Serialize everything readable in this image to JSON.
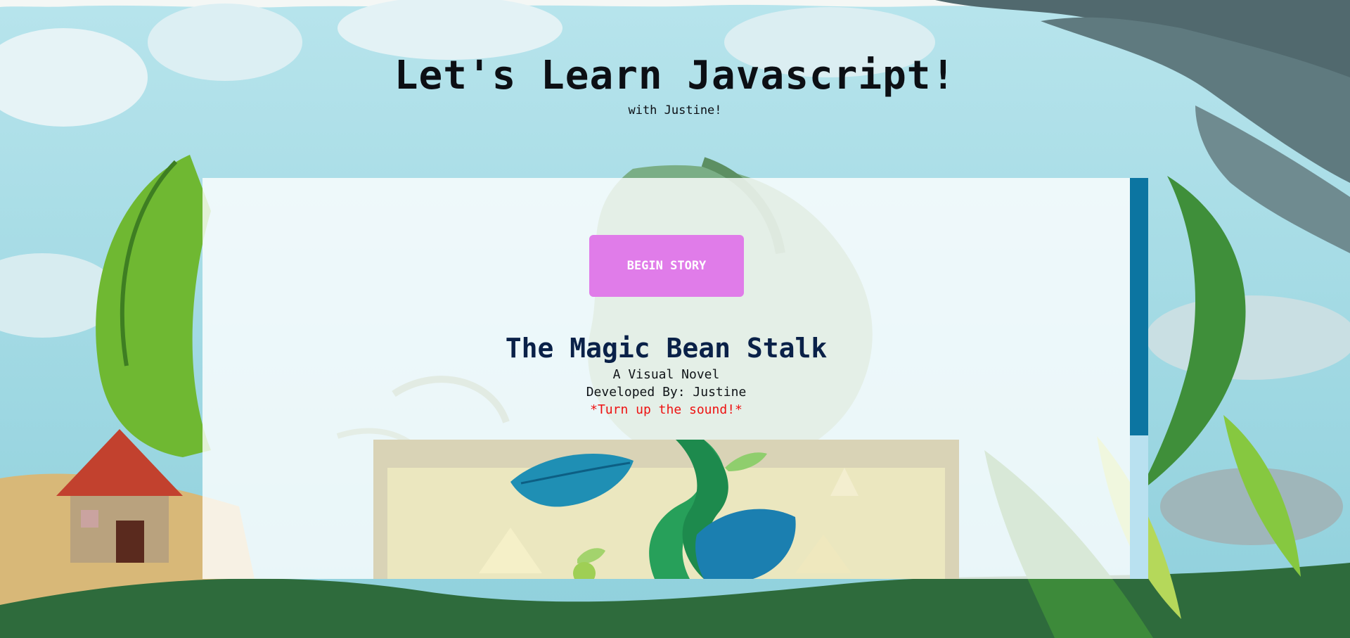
{
  "header": {
    "title": "Let's Learn Javascript!",
    "subtitle": "with Justine!"
  },
  "story": {
    "begin_label": "BEGIN STORY",
    "title": "The Magic Bean Stalk",
    "subtitle": "A Visual Novel",
    "developer": "Developed By: Justine",
    "sound_note": "*Turn up the sound!*"
  },
  "colors": {
    "button": "#e07ce9",
    "story_title": "#0a2148",
    "warning": "#ee1111",
    "scroll_thumb": "#0c75a1",
    "scroll_track": "#b9e1f0"
  },
  "icons": {
    "background": "beanstalk-illustration",
    "cover": "beanstalk-cover-illustration"
  }
}
